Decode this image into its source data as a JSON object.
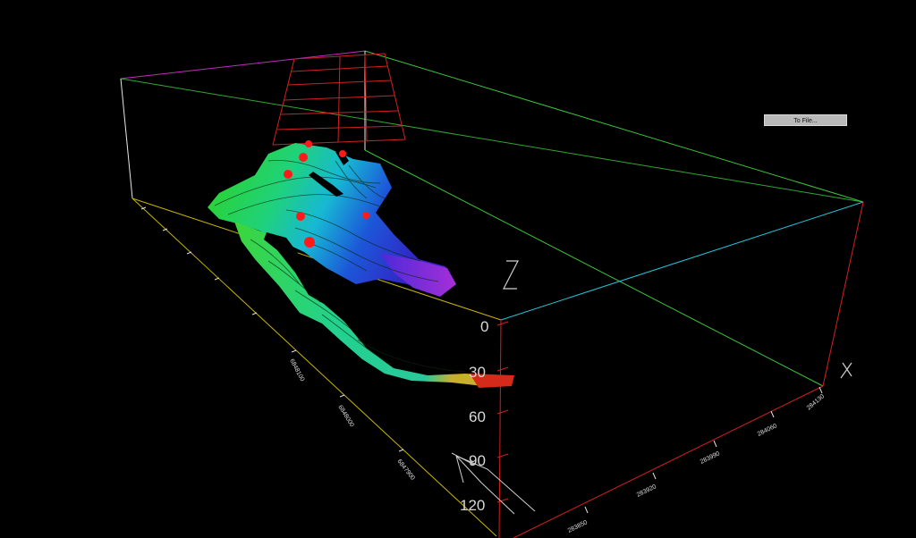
{
  "toolbar": {
    "to_file_label": "To File..."
  },
  "scene": {
    "background_color": "#000000",
    "axis_titles": {
      "z": "Z",
      "x": "X"
    },
    "z_axis_ticks": [
      "0",
      "30",
      "60",
      "90",
      "120"
    ],
    "x_axis_ticks": [
      "283850",
      "283920",
      "283990",
      "284060",
      "284130"
    ],
    "y_axis_ticks": [
      "",
      "",
      "",
      "",
      "",
      "6848100",
      "6848000",
      "6847900"
    ],
    "colors": {
      "box_edge_yellow": "#c8b400",
      "box_edge_green": "#39c43a",
      "box_edge_cyan": "#21c3d8",
      "box_edge_red": "#d41f1f",
      "box_edge_magenta": "#c22bc2",
      "box_edge_white": "#e8e8e8",
      "drillhole_marker": "#ff1a1a",
      "surface_red_grid": "#d02020"
    }
  }
}
